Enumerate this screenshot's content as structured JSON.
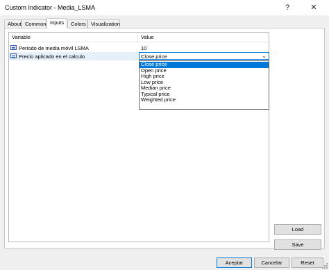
{
  "window": {
    "title": "Custom Indicator - Media_LSMA",
    "help_label": "?",
    "close_label": "✕"
  },
  "tabs": [
    {
      "label": "About"
    },
    {
      "label": "Common"
    },
    {
      "label": "Inputs"
    },
    {
      "label": "Colors"
    },
    {
      "label": "Visualization"
    }
  ],
  "active_tab": "Inputs",
  "grid": {
    "headers": {
      "variable": "Variable",
      "value": "Value"
    },
    "rows": [
      {
        "variable": "Periodo de media móvil LSMA",
        "value": "10"
      },
      {
        "variable": "Precio aplicado en el calculo",
        "value": "Close price"
      }
    ]
  },
  "dropdown": {
    "selected": "Close price",
    "options": [
      {
        "label": "Close price"
      },
      {
        "label": "Open price"
      },
      {
        "label": "High price"
      },
      {
        "label": "Low price"
      },
      {
        "label": "Median price"
      },
      {
        "label": "Typical price"
      },
      {
        "label": "Weighted price"
      }
    ]
  },
  "side_buttons": {
    "load": "Load",
    "save": "Save"
  },
  "footer": {
    "accept": "Aceptar",
    "cancel": "Cancelar",
    "reset": "Reset"
  }
}
